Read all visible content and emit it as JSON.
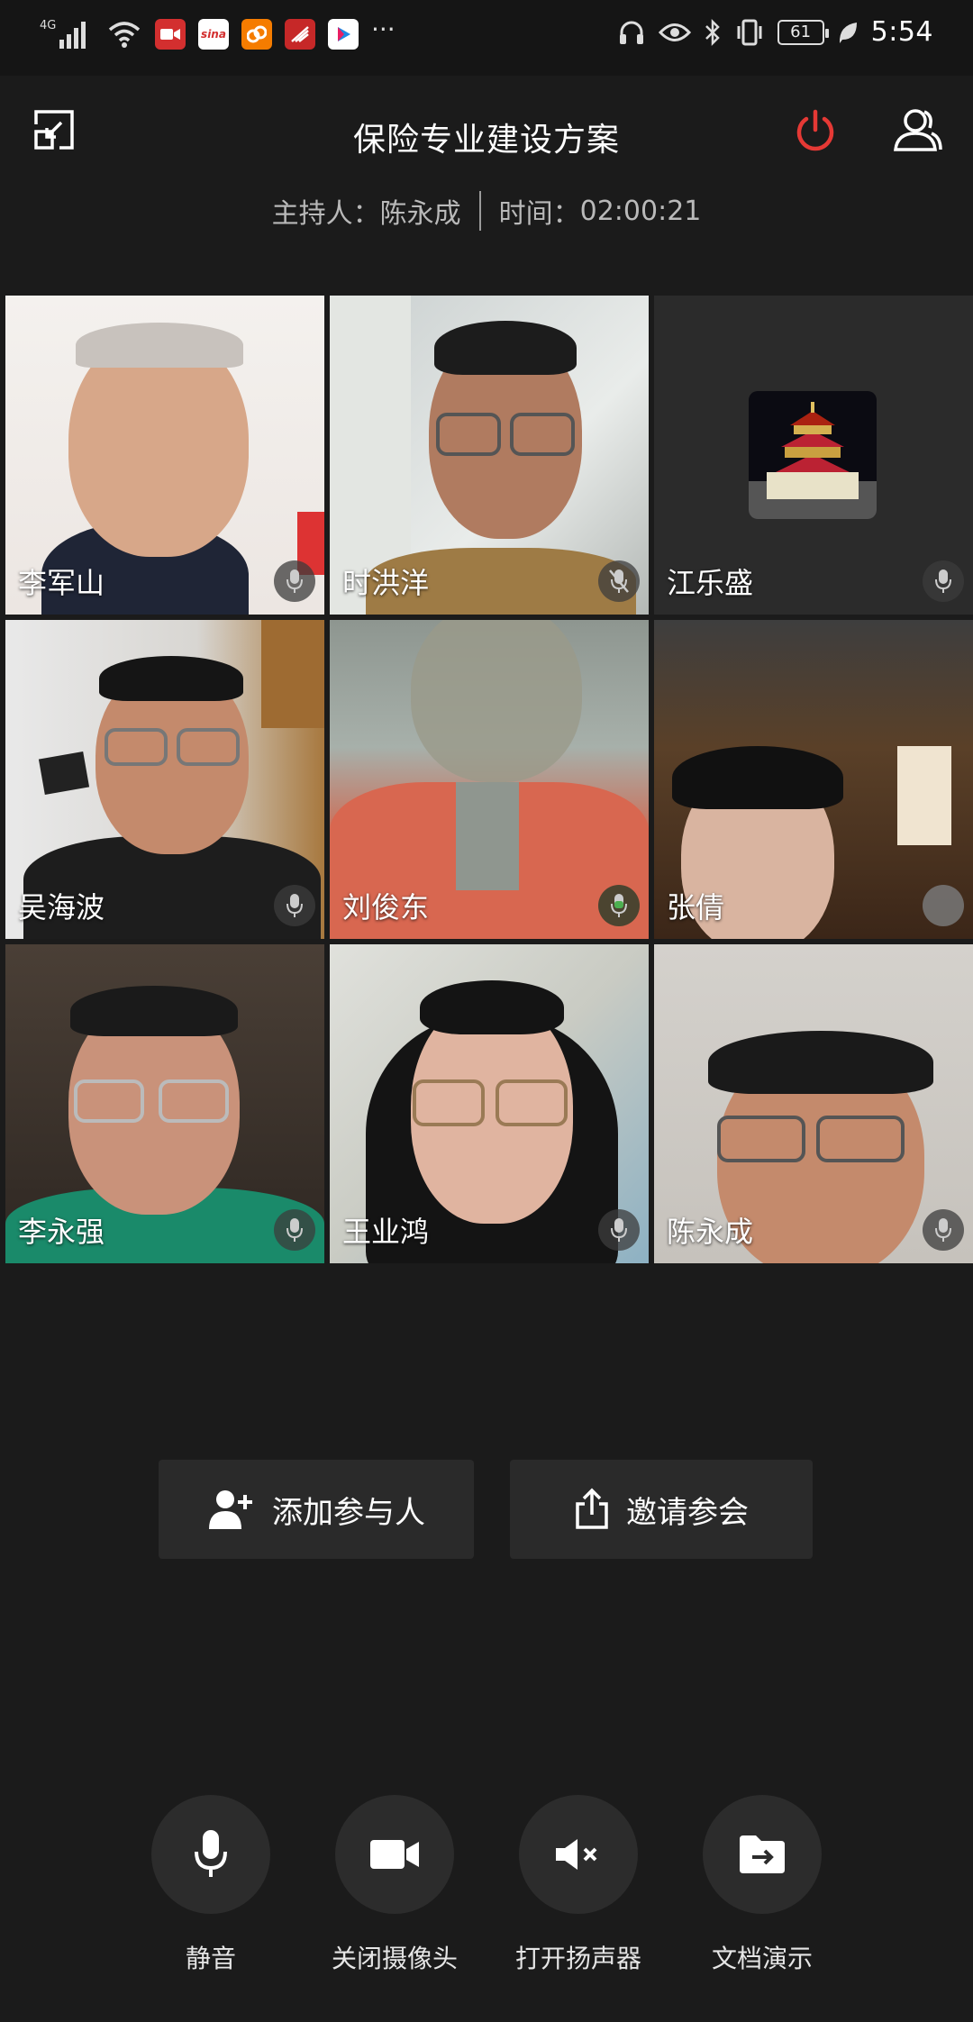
{
  "status_bar": {
    "network": "4G",
    "app_icons": [
      "video-app",
      "sina",
      "uc",
      "app-4",
      "youku"
    ],
    "more": "···",
    "battery": "61",
    "time": "5:54"
  },
  "header": {
    "title": "保险专业建设方案",
    "host_label": "主持人：",
    "host_name": "陈永成",
    "time_label": "时间：",
    "time_value": "02:00:21"
  },
  "participants": [
    {
      "name": "李军山",
      "mic": "default"
    },
    {
      "name": "时洪洋",
      "mic": "muted"
    },
    {
      "name": "江乐盛",
      "mic": "default"
    },
    {
      "name": "吴海波",
      "mic": "default"
    },
    {
      "name": "刘俊东",
      "mic": "speaking"
    },
    {
      "name": "张倩",
      "mic": "hidden"
    },
    {
      "name": "李永强",
      "mic": "default"
    },
    {
      "name": "王业鸿",
      "mic": "default"
    },
    {
      "name": "陈永成",
      "mic": "default"
    }
  ],
  "actions": {
    "add_participant": "添加参与人",
    "invite": "邀请参会"
  },
  "toolbar": {
    "mute": "静音",
    "camera_off": "关闭摄像头",
    "speaker_on": "打开扬声器",
    "doc_present": "文档演示"
  },
  "colors": {
    "background": "#1b1b1b",
    "power_red": "#e53935",
    "speaking_green": "#4caf50"
  }
}
